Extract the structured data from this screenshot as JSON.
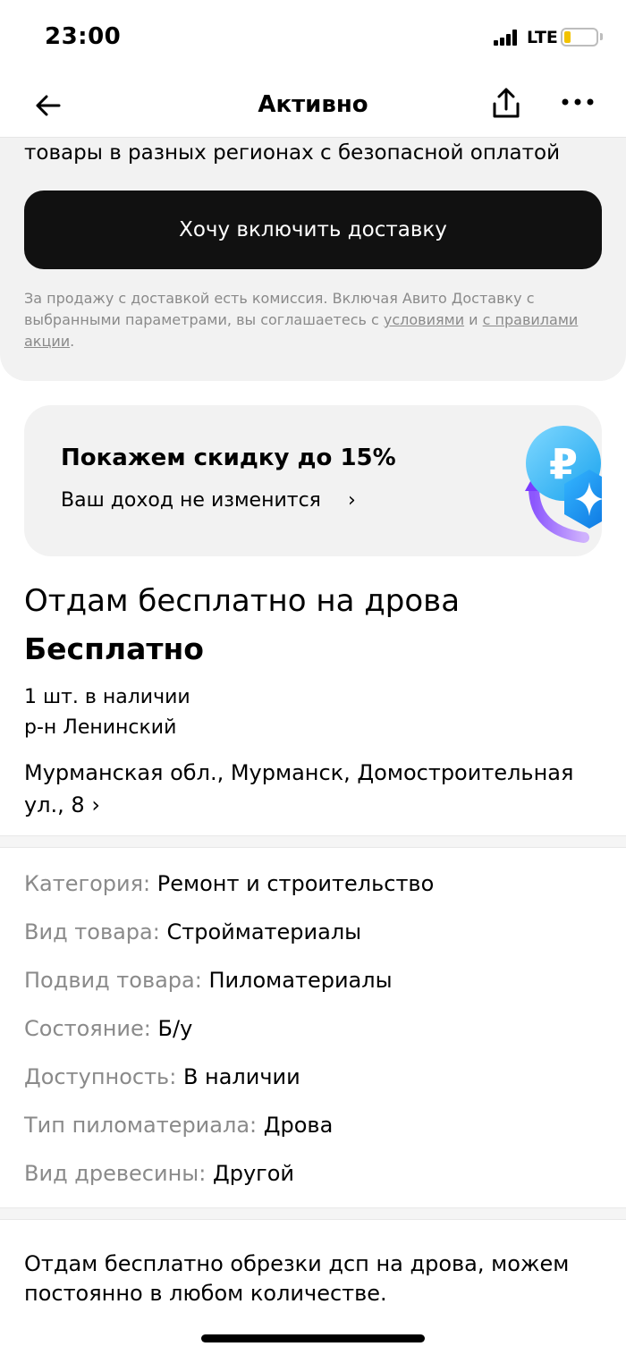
{
  "status_bar": {
    "time": "23:00",
    "network": "LTE",
    "battery_level": 0.2,
    "battery_color": "#f2c200"
  },
  "nav": {
    "title": "Активно",
    "back_icon": "arrow-left-icon",
    "share_icon": "share-icon",
    "more_icon": "more-horizontal-icon"
  },
  "delivery": {
    "tail_text": "товары в разных регионах с безопасной оплатой",
    "button_label": "Хочу включить доставку",
    "terms_text": "За продажу с доставкой есть комиссия. Включая Авито Доставку с выбранными параметрами, вы соглашаетесь с ",
    "terms_link_1": "условиями",
    "terms_mid": " и ",
    "terms_link_2": "с правилами акции",
    "terms_end": "."
  },
  "promo": {
    "title": "Покажем скидку до 15%",
    "subtitle": "Ваш доход не изменится",
    "chevron": "›",
    "graphic_icon": "ruble-coin-icon"
  },
  "item": {
    "title": "Отдам бесплатно на дрова",
    "price": "Бесплатно",
    "stock": "1 шт. в наличии",
    "district": "р-н Ленинский",
    "address": "Мурманская обл., Мурманск, Домостроительная ул., 8",
    "address_chevron": "›"
  },
  "params": [
    {
      "label": "Категория:",
      "value": "Ремонт и строительство"
    },
    {
      "label": "Вид товара:",
      "value": "Стройматериалы"
    },
    {
      "label": "Подвид товара:",
      "value": "Пиломатериалы"
    },
    {
      "label": "Состояние:",
      "value": "Б/у"
    },
    {
      "label": "Доступность:",
      "value": "В наличии"
    },
    {
      "label": "Тип пиломатериала:",
      "value": "Дрова"
    },
    {
      "label": "Вид древесины:",
      "value": "Другой"
    }
  ],
  "description": "Отдам бесплатно обрезки дсп на дрова, можем постоянно в любом количестве."
}
